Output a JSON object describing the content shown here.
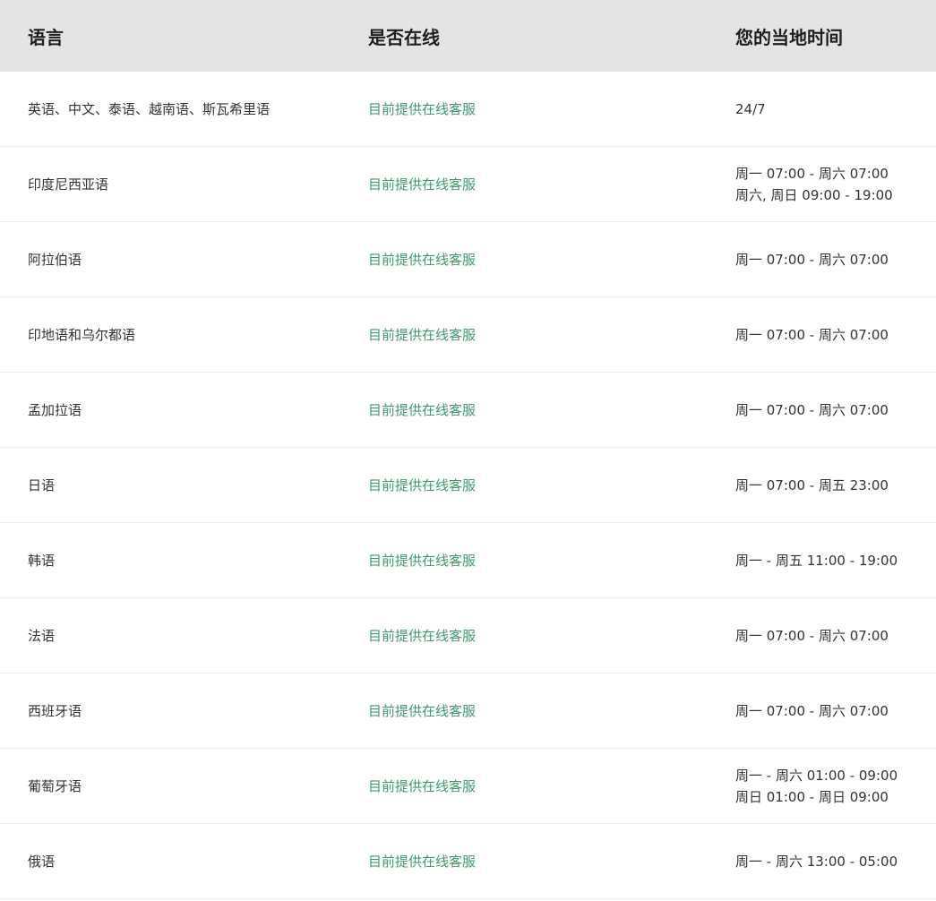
{
  "header": {
    "language": "语言",
    "online": "是否在线",
    "local_time": "您的当地时间"
  },
  "colors": {
    "header_bg": "#e3e4e6",
    "status_green": "#3f9a6e",
    "divider": "#ececec"
  },
  "rows": [
    {
      "language": "英语、中文、泰语、越南语、斯瓦希里语",
      "status": "目前提供在线客服",
      "time1": "24/7",
      "time2": ""
    },
    {
      "language": "印度尼西亚语",
      "status": "目前提供在线客服",
      "time1": "周一 07:00 - 周六 07:00",
      "time2": "周六, 周日 09:00 - 19:00"
    },
    {
      "language": "阿拉伯语",
      "status": "目前提供在线客服",
      "time1": "周一 07:00 - 周六 07:00",
      "time2": ""
    },
    {
      "language": "印地语和乌尔都语",
      "status": "目前提供在线客服",
      "time1": "周一 07:00 - 周六 07:00",
      "time2": ""
    },
    {
      "language": "孟加拉语",
      "status": "目前提供在线客服",
      "time1": "周一 07:00 - 周六 07:00",
      "time2": ""
    },
    {
      "language": "日语",
      "status": "目前提供在线客服",
      "time1": "周一 07:00 - 周五 23:00",
      "time2": ""
    },
    {
      "language": "韩语",
      "status": "目前提供在线客服",
      "time1": "周一 - 周五 11:00 - 19:00",
      "time2": ""
    },
    {
      "language": "法语",
      "status": "目前提供在线客服",
      "time1": "周一 07:00 - 周六 07:00",
      "time2": ""
    },
    {
      "language": "西班牙语",
      "status": "目前提供在线客服",
      "time1": "周一 07:00 - 周六 07:00",
      "time2": ""
    },
    {
      "language": "葡萄牙语",
      "status": "目前提供在线客服",
      "time1": "周一 - 周六 01:00 - 09:00",
      "time2": "周日 01:00 - 周日 09:00"
    },
    {
      "language": "俄语",
      "status": "目前提供在线客服",
      "time1": "周一 - 周六 13:00 - 05:00",
      "time2": ""
    }
  ]
}
